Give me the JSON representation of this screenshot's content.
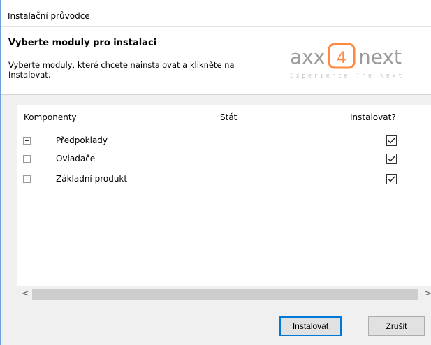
{
  "window": {
    "title": "Instalační průvodce"
  },
  "header": {
    "title": "Vyberte moduly pro instalaci",
    "description": "Vyberte moduly, které chcete nainstalovat a klikněte na Instalovat.",
    "logo": {
      "brand_left": "axx",
      "brand_digit": "4",
      "brand_right": "next",
      "tagline": "Experience The Next",
      "accent_color": "#ff8a3d",
      "gray_color": "#9b9b9b"
    }
  },
  "table": {
    "columns": [
      "Komponenty",
      "Stát",
      "Instalovat?"
    ],
    "rows": [
      {
        "label": "Předpoklady",
        "checked": true
      },
      {
        "label": "Ovladače",
        "checked": true
      },
      {
        "label": "Základní produkt",
        "checked": true
      }
    ]
  },
  "scrollbar": {
    "left_arrow": "<",
    "right_arrow": ">"
  },
  "buttons": {
    "install": "Instalovat",
    "cancel": "Zrušit"
  }
}
